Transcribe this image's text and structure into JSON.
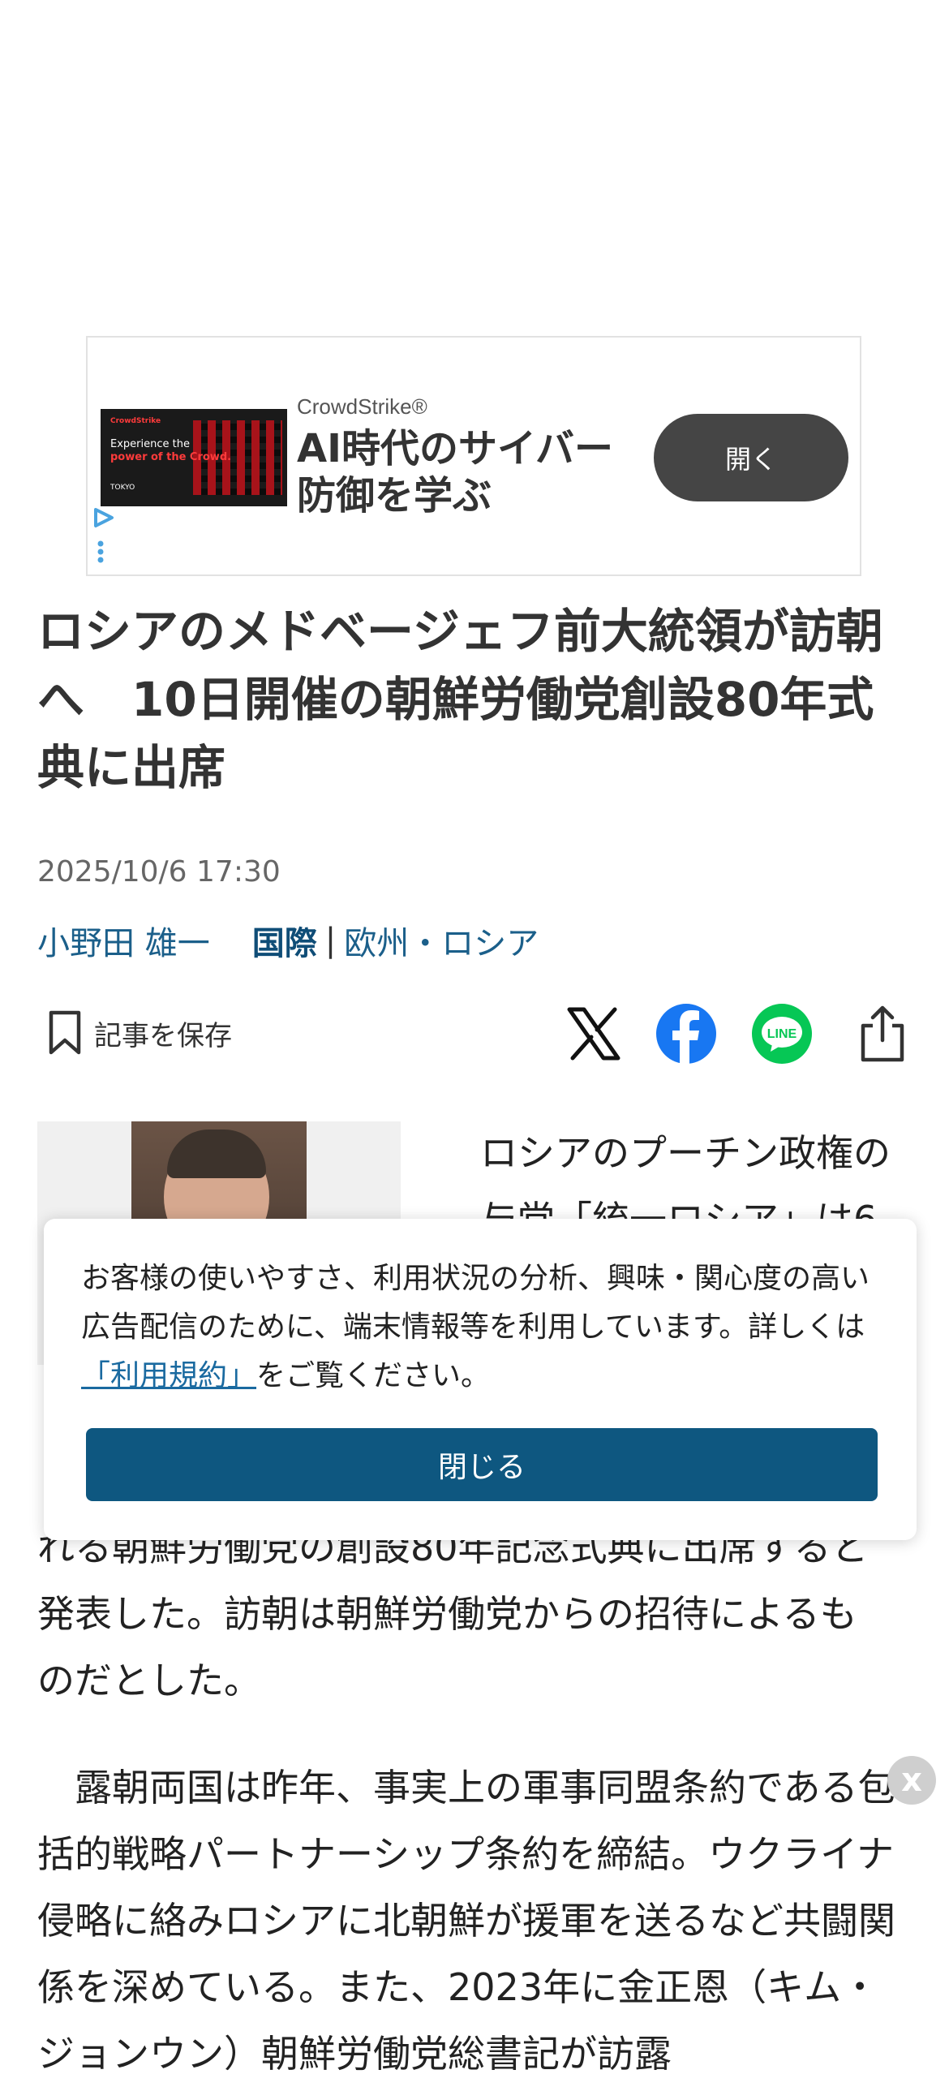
{
  "ad": {
    "brand": "CrowdStrike®",
    "headline": "AI時代のサイバー防御を学ぶ",
    "open_label": "開く",
    "image_text_1": "Experience the",
    "image_text_bold": "power of the Crowd.",
    "image_city": "TOKYO",
    "image_logo": "CrowdStrike"
  },
  "article": {
    "title": "ロシアのメドベージェフ前大統領が訪朝へ　10日開催の朝鮮労働党創設80年式典に出席",
    "date": "2025/10/6 17:30",
    "author": "小野田 雄一",
    "category": "国際",
    "separator": "|",
    "subcategory": "欧州・ロシア",
    "save_label": "記事を保存",
    "lead_partial": "ロシアのプーチン政権の",
    "lead_partial_2": "与党「統一ロシア」は6",
    "paragraph1_end_1": "れる朝鮮労働党の創設80年記念式典に出席すると",
    "paragraph1_end_2": "発表した。訪朝は朝鮮労働党からの招待によるも",
    "paragraph1_end_3": "のだとした。",
    "paragraph2": "露朝両国は昨年、事実上の軍事同盟条約である包括的戦略パートナーシップ条約を締結。ウクライナ侵略に絡みロシアに北朝鮮が援軍を送るなど共闘関係を深めている。また、2023年に金正恩（キム・ジョンウン）朝鮮労働党総書記が訪露"
  },
  "consent": {
    "text_before": "お客様の使いやすさ、利用状況の分析、興味・関心度の高い広告配信のために、端末情報等を利用しています。詳しくは",
    "link": "「利用規約」",
    "text_after": "をご覧ください。",
    "close_label": "閉じる"
  },
  "floating_close": "x",
  "colors": {
    "accent": "#0e5780",
    "link": "#1b5f8a",
    "facebook": "#1877f2",
    "line": "#06c755"
  }
}
